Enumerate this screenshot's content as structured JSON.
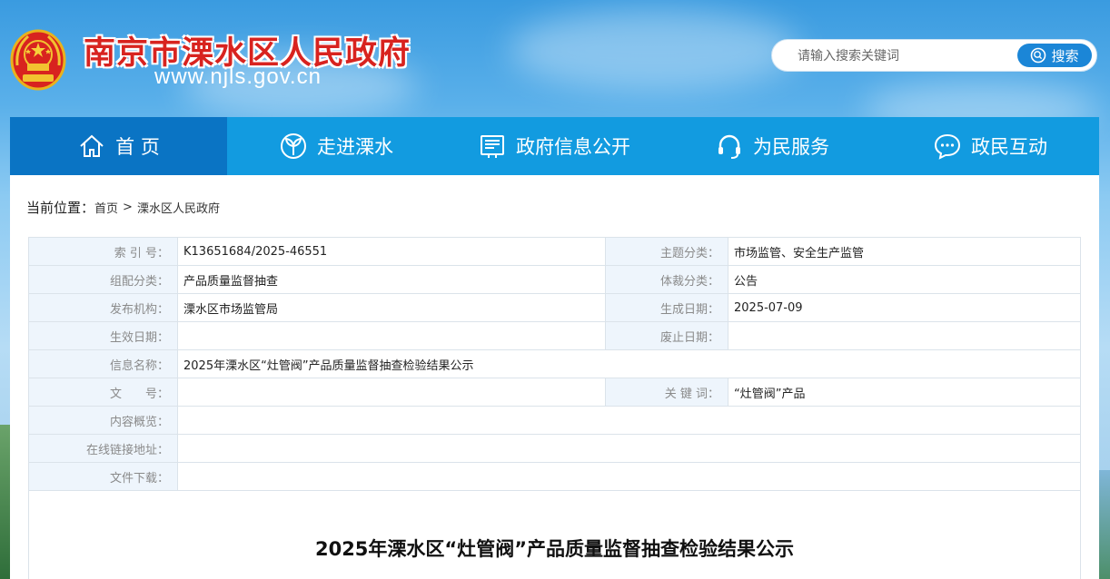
{
  "header": {
    "site_title": "南京市溧水区人民政府",
    "site_url": "www.njls.gov.cn",
    "search_placeholder": "请输入搜索关键词",
    "search_button": "搜索"
  },
  "nav": [
    {
      "label": "首 页",
      "icon": "home-icon",
      "active": true
    },
    {
      "label": "走进溧水",
      "icon": "leaf-icon",
      "active": false
    },
    {
      "label": "政府信息公开",
      "icon": "document-icon",
      "active": false
    },
    {
      "label": "为民服务",
      "icon": "headset-icon",
      "active": false
    },
    {
      "label": "政民互动",
      "icon": "chat-icon",
      "active": false
    }
  ],
  "breadcrumb": {
    "label": "当前位置：",
    "items": [
      "首页",
      "溧水区人民政府"
    ],
    "separator": ">"
  },
  "meta": {
    "index_no_label": "索 引 号：",
    "index_no": "K13651684/2025-46551",
    "topic_label": "主题分类：",
    "topic": "市场监管、安全生产监管",
    "group_label": "组配分类：",
    "group": "产品质量监督抽查",
    "genre_label": "体裁分类：",
    "genre": "公告",
    "publisher_label": "发布机构：",
    "publisher": "溧水区市场监管局",
    "created_label": "生成日期：",
    "created": "2025-07-09",
    "effective_label": "生效日期：",
    "effective": "",
    "expire_label": "废止日期：",
    "expire": "",
    "name_label": "信息名称：",
    "name": "2025年溧水区“灶管阀”产品质量监督抽查检验结果公示",
    "docno_label": "文　　号：",
    "docno": "",
    "keywords_label": "关 键 词：",
    "keywords": "“灶管阀”产品",
    "summary_label": "内容概览：",
    "summary": "",
    "link_label": "在线链接地址：",
    "link": "",
    "download_label": "文件下载：",
    "download": ""
  },
  "doc": {
    "title": "2025年溧水区“灶管阀”产品质量监督抽查检验结果公示"
  },
  "colors": {
    "nav_bg": "#129be0",
    "nav_active": "#0a74c4",
    "title_red": "#d8231f",
    "label_bg": "#eef5fc"
  }
}
